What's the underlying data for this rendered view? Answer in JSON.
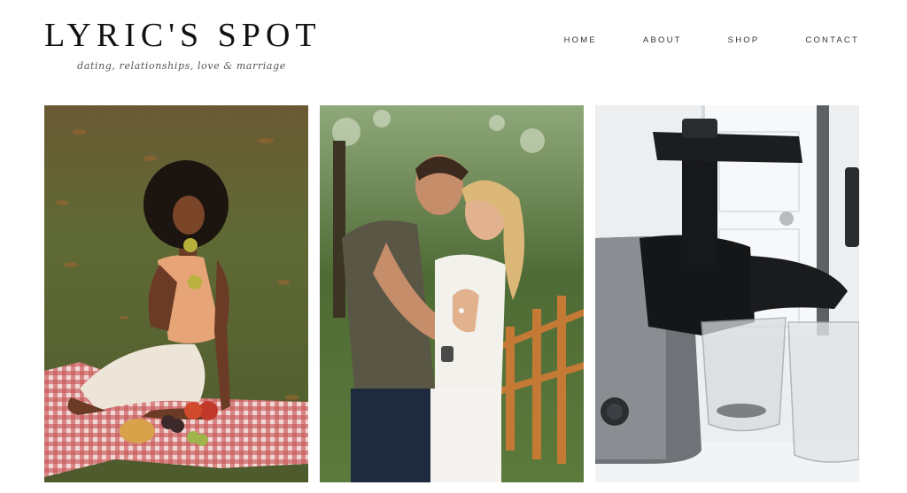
{
  "site": {
    "title": "LYRIC'S SPOT",
    "tagline": "dating, relationships, love & marriage"
  },
  "nav": {
    "items": [
      {
        "label": "HOME"
      },
      {
        "label": "ABOUT"
      },
      {
        "label": "SHOP"
      },
      {
        "label": "CONTACT"
      }
    ]
  },
  "posts": [
    {
      "image": "woman-picnic-apples-photo"
    },
    {
      "image": "engagement-couple-ring-photo"
    },
    {
      "image": "juicer-appliance-photo"
    }
  ]
}
